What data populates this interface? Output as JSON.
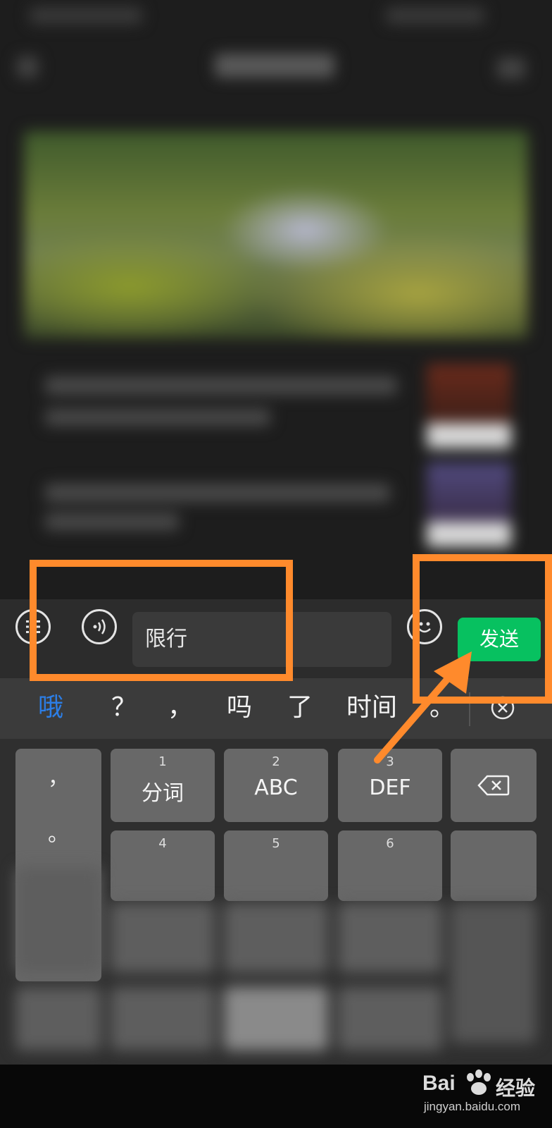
{
  "input_bar": {
    "text_value": "限行",
    "send_label": "发送"
  },
  "candidates": [
    "哦",
    "？",
    "，",
    "吗",
    "了",
    "时间",
    "。"
  ],
  "keyboard": {
    "punct_top": "，",
    "punct_bottom": "。",
    "keys_row1": [
      {
        "num": "1",
        "label": "分词"
      },
      {
        "num": "2",
        "label": "ABC"
      },
      {
        "num": "3",
        "label": "DEF"
      }
    ],
    "keys_row2_nums": [
      "4",
      "5",
      "6"
    ]
  },
  "watermark": {
    "brand": "Bai",
    "brand_suffix": "经验",
    "url": "jingyan.baidu.com"
  },
  "colors": {
    "send_green": "#07c160",
    "annotation_orange": "#ff8a2c",
    "candidate_highlight": "#2c7ee6"
  }
}
